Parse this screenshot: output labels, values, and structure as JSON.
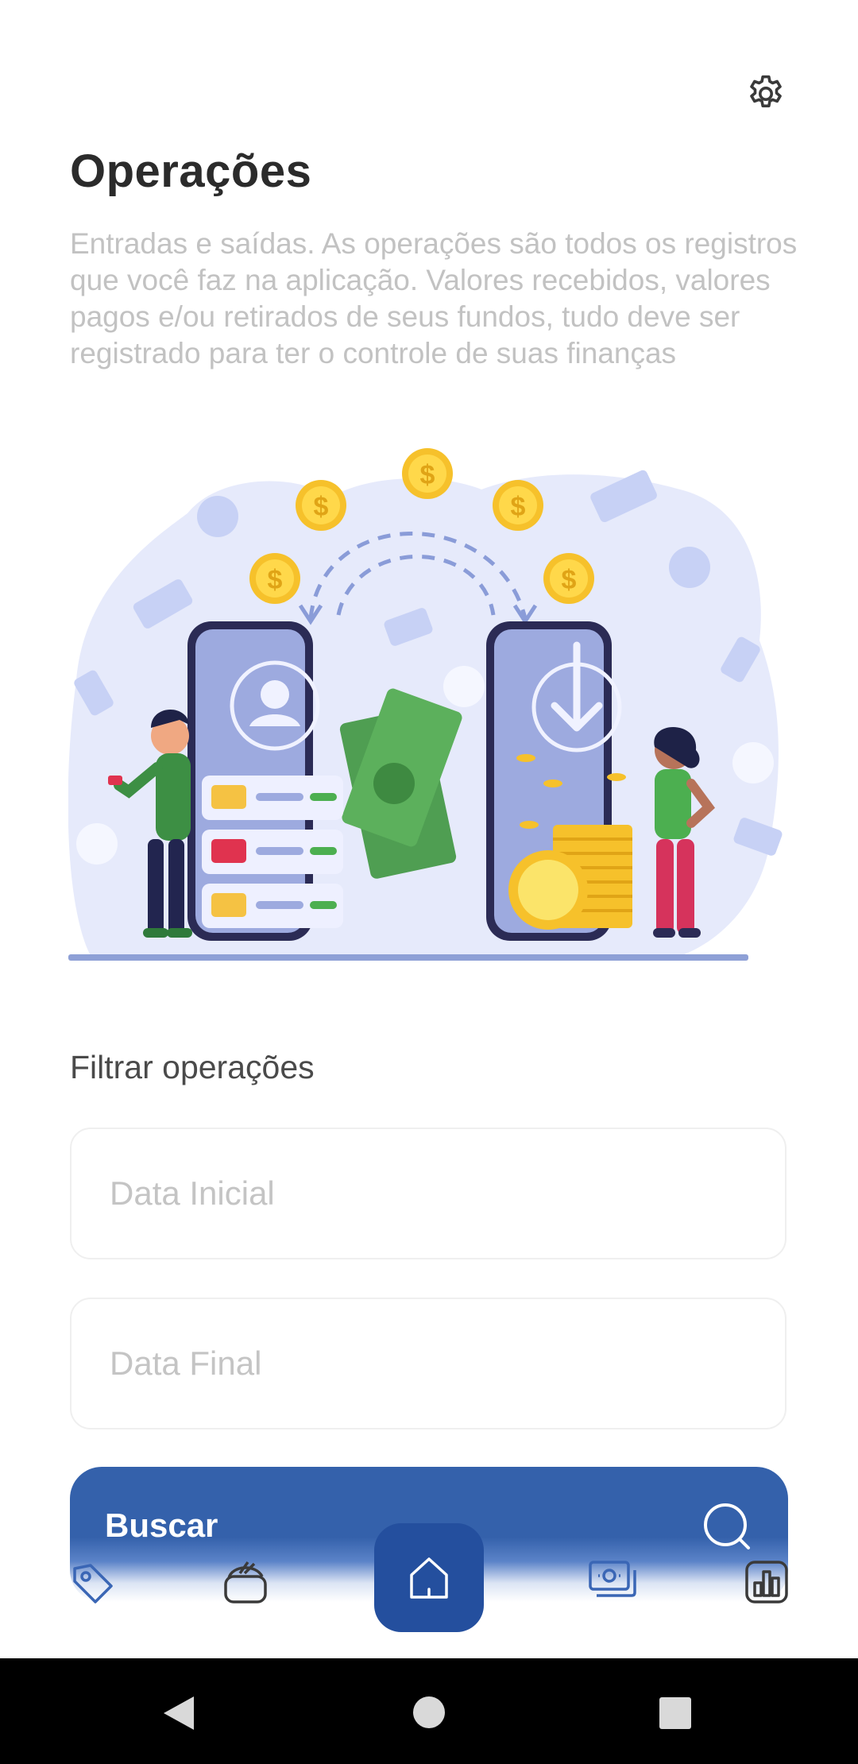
{
  "header": {
    "title": "Operações",
    "description": "Entradas e saídas. As operações são todos os registros que você faz na aplicação. Valores recebidos, valores pagos e/ou retirados de seus fundos, tudo deve ser registrado para ter o controle de suas finanças",
    "settings_icon": "gear-icon"
  },
  "filter": {
    "section_title": "Filtrar operações",
    "start_date": {
      "placeholder": "Data Inicial",
      "value": ""
    },
    "end_date": {
      "placeholder": "Data Final",
      "value": ""
    },
    "search_button": {
      "label": "Buscar",
      "icon": "search-icon"
    }
  },
  "bottom_nav": {
    "items": [
      {
        "name": "tag-icon",
        "active": false
      },
      {
        "name": "wallet-icon",
        "active": false
      },
      {
        "name": "home-icon",
        "active": true
      },
      {
        "name": "money-icon",
        "active": false
      },
      {
        "name": "bar-chart-icon",
        "active": false
      }
    ]
  },
  "system_nav": [
    "back-icon",
    "home-circle-icon",
    "recents-icon"
  ],
  "colors": {
    "primary": "#3461ab",
    "home_active": "#244f9e",
    "title": "#2b2b2b",
    "description": "#c2c2c2",
    "accent_blue": "#3a66b5"
  }
}
